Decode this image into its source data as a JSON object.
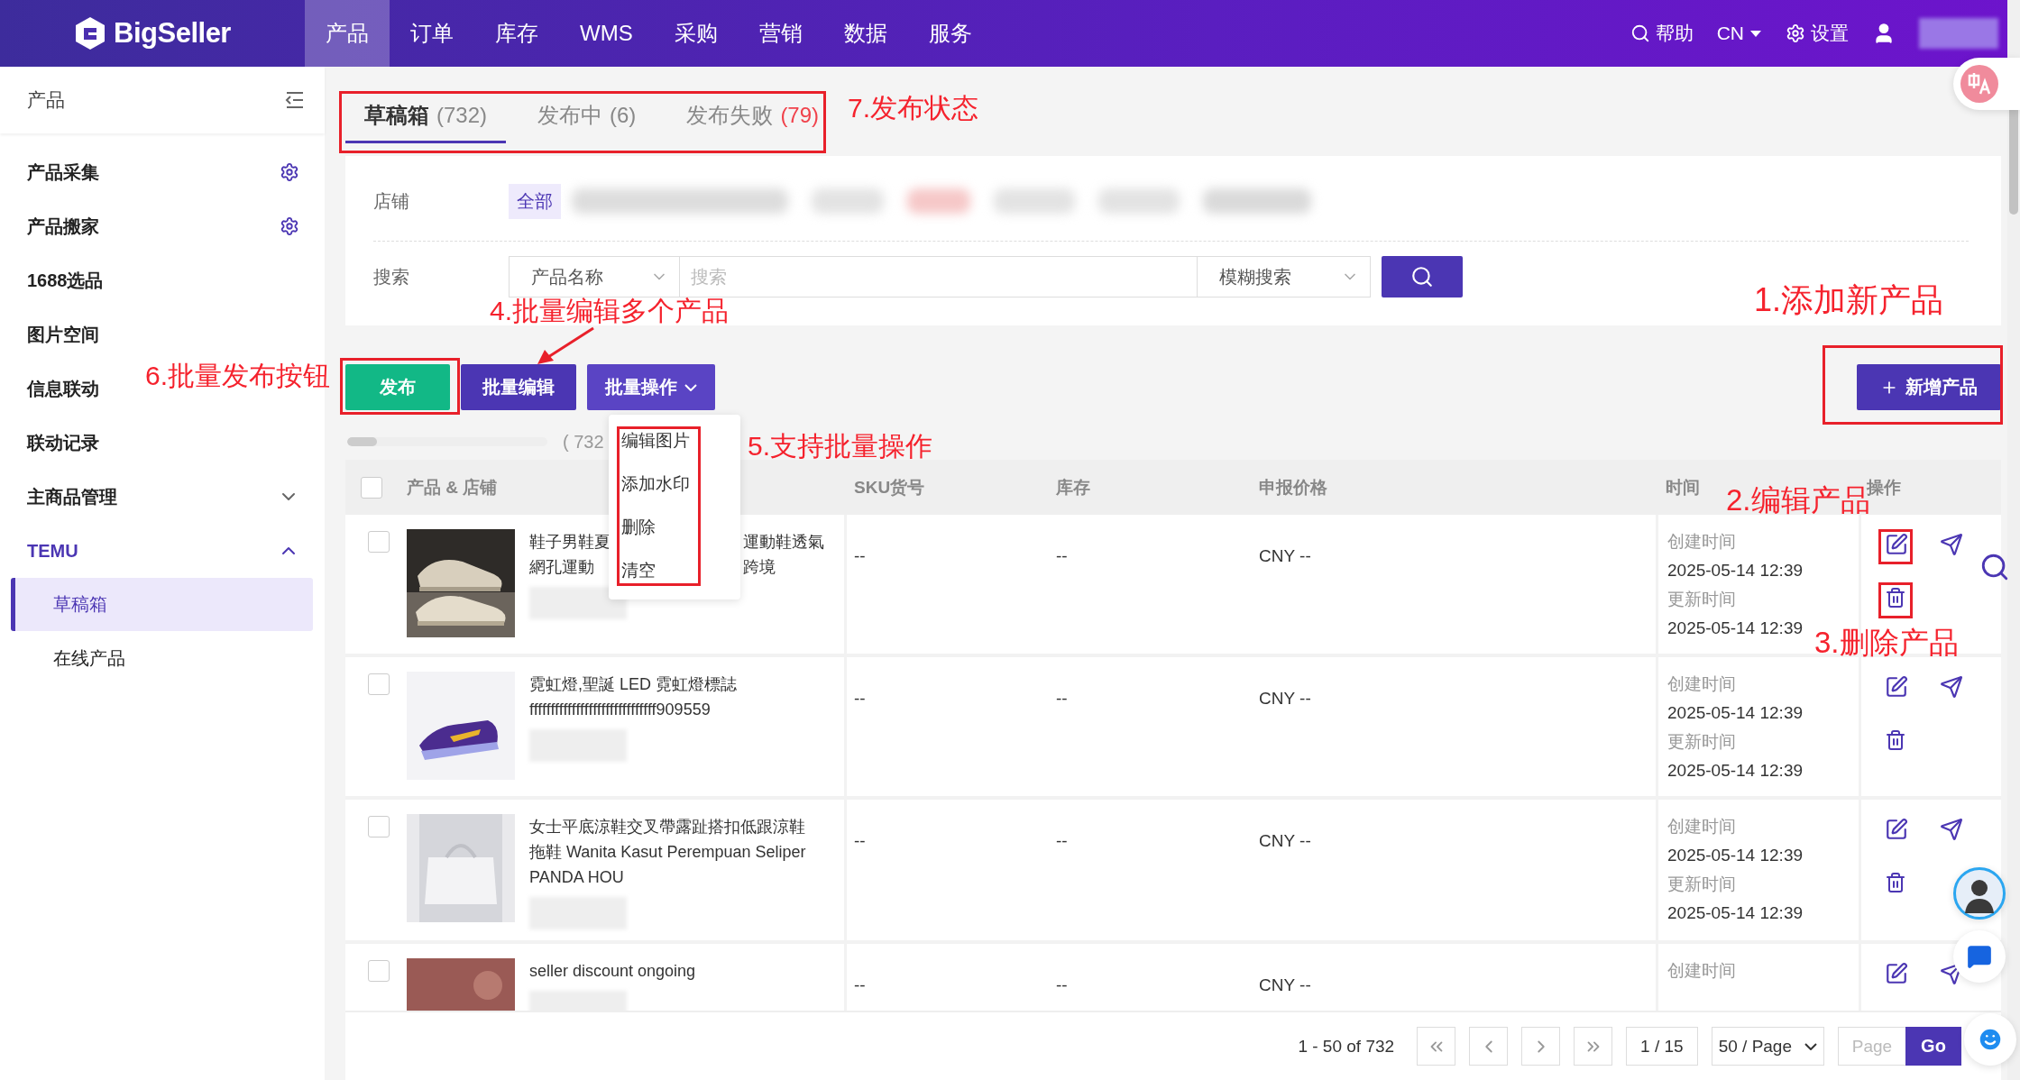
{
  "topbar": {
    "logo": "BigSeller",
    "nav": [
      {
        "label": "产品",
        "selected": true
      },
      {
        "label": "订单",
        "selected": false
      },
      {
        "label": "库存",
        "selected": false
      },
      {
        "label": "WMS",
        "selected": false
      },
      {
        "label": "采购",
        "selected": false
      },
      {
        "label": "营销",
        "selected": false
      },
      {
        "label": "数据",
        "selected": false
      },
      {
        "label": "服务",
        "selected": false
      }
    ],
    "help": "帮助",
    "language": "CN",
    "settings": "设置"
  },
  "sidebar": {
    "title": "产品",
    "items": [
      {
        "label": "产品采集",
        "kind": "gear"
      },
      {
        "label": "产品搬家",
        "kind": "gear"
      },
      {
        "label": "1688选品",
        "kind": "plain"
      },
      {
        "label": "图片空间",
        "kind": "plain"
      },
      {
        "label": "信息联动",
        "kind": "plain"
      },
      {
        "label": "联动记录",
        "kind": "plain"
      },
      {
        "label": "主商品管理",
        "kind": "group",
        "expanded": false
      },
      {
        "label": "TEMU",
        "kind": "group",
        "expanded": true,
        "children": [
          {
            "label": "草稿箱",
            "selected": true
          },
          {
            "label": "在线产品",
            "selected": false
          }
        ]
      }
    ]
  },
  "tabs": [
    {
      "label": "草稿箱",
      "count": "(732)",
      "selected": true,
      "alert": false
    },
    {
      "label": "发布中",
      "count": "(6)",
      "selected": false,
      "alert": false
    },
    {
      "label": "发布失败",
      "count": "(79)",
      "selected": false,
      "alert": true
    }
  ],
  "filters": {
    "store_label": "店铺",
    "store_all": "全部",
    "search_label": "搜索",
    "field_select": "产品名称",
    "search_placeholder": "搜索",
    "mode_select": "模糊搜索"
  },
  "actions": {
    "publish": "发布",
    "batch_edit": "批量编辑",
    "batch_ops": "批量操作",
    "add": "新增产品"
  },
  "batch_menu": [
    "编辑图片",
    "添加水印",
    "删除",
    "清空"
  ],
  "progress": {
    "level": 0.15,
    "label": "( 732"
  },
  "table": {
    "select_all_checked": false,
    "columns": [
      "产品 & 店铺",
      "SKU货号",
      "库存",
      "申报价格",
      "时间",
      "操作"
    ],
    "rows": [
      {
        "checked": false,
        "kind": "picture",
        "title_lines": [
          [
            "鞋子男鞋夏",
            "運動鞋透氣"
          ],
          [
            "網孔運動",
            "跨境"
          ]
        ],
        "sku": "--",
        "stock": "--",
        "price": "CNY --",
        "created_label": "创建时间",
        "created": "2025-05-14 12:39",
        "updated_label": "更新时间",
        "updated": "2025-05-14 12:39"
      },
      {
        "checked": false,
        "kind": "picture",
        "title_lines": [
          [
            "霓虹燈,聖誕 LED 霓虹燈標誌"
          ],
          [
            "ffffffffffffffffffffffffffffff909559"
          ]
        ],
        "sku": "--",
        "stock": "--",
        "price": "CNY --",
        "created_label": "创建时间",
        "created": "2025-05-14 12:39",
        "updated_label": "更新时间",
        "updated": "2025-05-14 12:39"
      },
      {
        "checked": false,
        "kind": "picture",
        "title_lines": [
          [
            "女士平底涼鞋交叉帶露趾搭扣低跟涼鞋"
          ],
          [
            "拖鞋 Wanita Kasut Perempuan Seliper"
          ],
          [
            "PANDA HOU"
          ]
        ],
        "sku": "--",
        "stock": "--",
        "price": "CNY --",
        "created_label": "创建时间",
        "created": "2025-05-14 12:39",
        "updated_label": "更新时间",
        "updated": "2025-05-14 12:39"
      },
      {
        "checked": false,
        "kind": "picture",
        "title_lines": [
          [
            "seller discount ongoing"
          ]
        ],
        "sku": "--",
        "stock": "--",
        "price": "CNY --",
        "created_label": "创建时间"
      }
    ]
  },
  "pagination": {
    "range": "1 - 50 of 732",
    "page": "1 / 15",
    "page_size": "50 / Page",
    "page_placeholder": "Page",
    "go": "Go"
  },
  "annotations": [
    {
      "text": "7.发布状态"
    },
    {
      "text": "1.添加新产品"
    },
    {
      "text": "4.批量编辑多个产品"
    },
    {
      "text": "6.批量发布按钮"
    },
    {
      "text": "5.支持批量操作"
    },
    {
      "text": "2.编辑产品"
    },
    {
      "text": "3.删除产品"
    }
  ]
}
